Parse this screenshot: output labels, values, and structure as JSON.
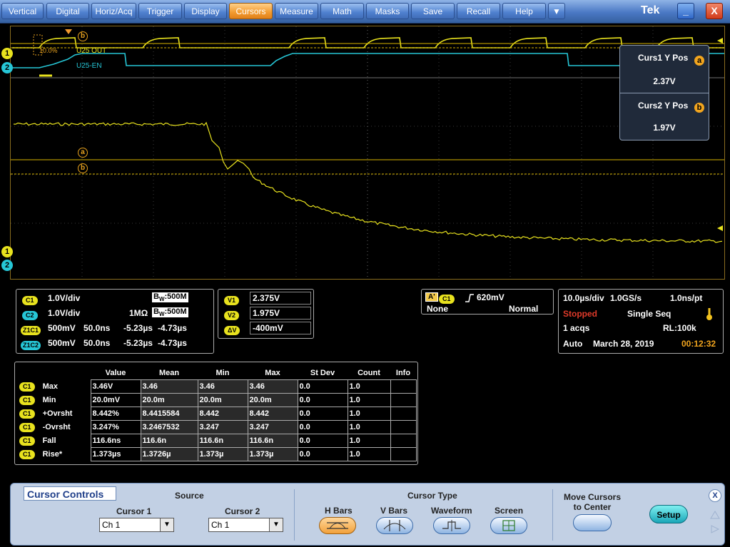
{
  "menu": [
    "Vertical",
    "Digital",
    "Horiz/Acq",
    "Trigger",
    "Display",
    "Cursors",
    "Measure",
    "Math",
    "Masks",
    "Save",
    "Recall",
    "Help"
  ],
  "menu_active": "Cursors",
  "menu_more": "▼",
  "brand": "Tek",
  "window": {
    "minimize": "_",
    "close": "X"
  },
  "channels": {
    "ch1_marker": "1",
    "ch2_marker": "2"
  },
  "bus_labels": {
    "out": "U25 OUT",
    "en": "U25-EN",
    "pct": "10.0%"
  },
  "cursor_labels": {
    "a": "a",
    "b": "b"
  },
  "cursor_box": {
    "curs1_label": "Curs1 Y Pos",
    "curs1_value": "2.37V",
    "curs2_label": "Curs2 Y Pos",
    "curs2_value": "1.97V"
  },
  "vertical": {
    "rows": [
      {
        "tag": "C1",
        "scale": "1.0V/div",
        "coupling": "",
        "bw_prefix": "B",
        "bw_sub": "W",
        "bw": ":500M"
      },
      {
        "tag": "C2",
        "scale": "1.0V/div",
        "coupling": "1MΩ",
        "bw_prefix": "B",
        "bw_sub": "W",
        "bw": ":500M"
      },
      {
        "tag": "Z1C1",
        "scale": "500mV",
        "time": "50.0ns",
        "t1": "-5.23µs",
        "t2": "-4.73µs"
      },
      {
        "tag": "Z1C2",
        "scale": "500mV",
        "time": "50.0ns",
        "t1": "-5.23µs",
        "t2": "-4.73µs"
      }
    ]
  },
  "cursor_readout": {
    "v1_tag": "V1",
    "v1": "2.375V",
    "v2_tag": "V2",
    "v2": "1.975V",
    "dv_tag": "ΔV",
    "dv": "-400mV"
  },
  "trigger": {
    "a_tag": "A'",
    "src": "C1",
    "level": "620mV",
    "coupling": "None",
    "mode": "Normal"
  },
  "acquisition": {
    "timebase": "10.0µs/div",
    "rate": "1.0GS/s",
    "res": "1.0ns/pt",
    "state": "Stopped",
    "mode": "Single Seq",
    "acqs": "1 acqs",
    "rl": "RL:100k",
    "trig_mode": "Auto",
    "date": "March 28, 2019",
    "time": "00:12:32"
  },
  "measurements": {
    "headers": [
      "Value",
      "Mean",
      "Min",
      "Max",
      "St Dev",
      "Count",
      "Info"
    ],
    "rows": [
      {
        "tag": "C1",
        "name": "Max",
        "cells": [
          "3.46V",
          "3.46",
          "3.46",
          "3.46",
          "0.0",
          "1.0",
          ""
        ]
      },
      {
        "tag": "C1",
        "name": "Min",
        "cells": [
          "20.0mV",
          "20.0m",
          "20.0m",
          "20.0m",
          "0.0",
          "1.0",
          ""
        ]
      },
      {
        "tag": "C1",
        "name": "+Ovrsht",
        "cells": [
          "8.442%",
          "8.4415584",
          "8.442",
          "8.442",
          "0.0",
          "1.0",
          ""
        ]
      },
      {
        "tag": "C1",
        "name": "-Ovrsht",
        "cells": [
          "3.247%",
          "3.2467532",
          "3.247",
          "3.247",
          "0.0",
          "1.0",
          ""
        ]
      },
      {
        "tag": "C1",
        "name": "Fall",
        "cells": [
          "116.6ns",
          "116.6n",
          "116.6n",
          "116.6n",
          "0.0",
          "1.0",
          ""
        ]
      },
      {
        "tag": "C1",
        "name": "Rise*",
        "cells": [
          "1.373µs",
          "1.3726µ",
          "1.373µ",
          "1.373µ",
          "0.0",
          "1.0",
          ""
        ]
      }
    ]
  },
  "controls": {
    "title": "Cursor Controls",
    "source_label": "Source",
    "cursor1_label": "Cursor 1",
    "cursor1_value": "Ch 1",
    "cursor2_label": "Cursor 2",
    "cursor2_value": "Ch 1",
    "cursor_type_label": "Cursor Type",
    "types": [
      "H Bars",
      "V Bars",
      "Waveform",
      "Screen"
    ],
    "selected_type": "H Bars",
    "move_label": "Move Cursors to Center",
    "setup_label": "Setup",
    "close_icon": "X"
  },
  "colors": {
    "ch1": "#e8e21e",
    "ch2": "#26c6d6",
    "accent": "#f29a2e",
    "cursor": "#d8b400"
  }
}
